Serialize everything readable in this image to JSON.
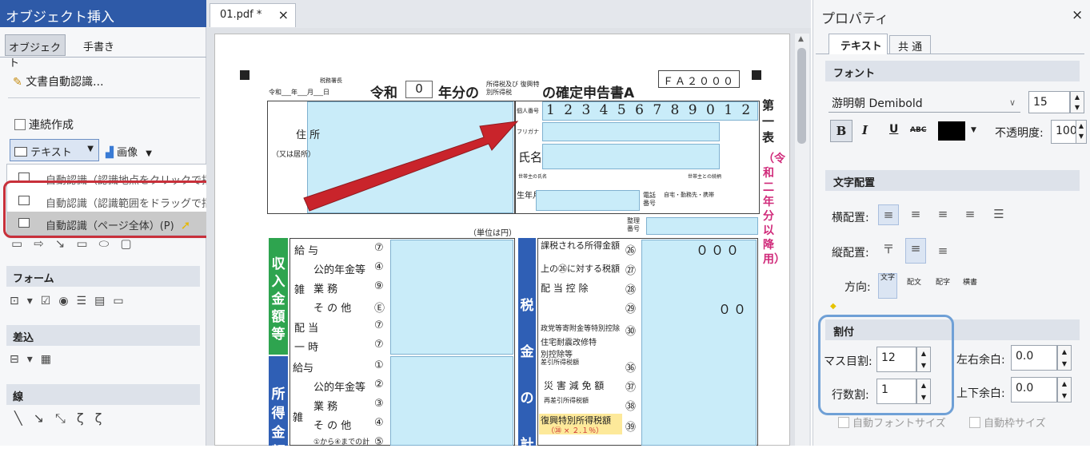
{
  "left_panel": {
    "title": "オブジェクト挿入",
    "close": "×",
    "tabs": [
      "オブジェクト",
      "手書き"
    ],
    "auto_recognize": "文書自動認識...",
    "continuous": "連続作成",
    "text_btn": "テキスト",
    "image_btn": "画像",
    "menu": [
      "自動認識（認識地点をクリックで指定）(M)",
      "自動認識（認識範囲をドラッグで指定）(A)",
      "自動認識（ページ全体）(P)"
    ],
    "sections": {
      "form": "フォーム",
      "merge": "差込",
      "line": "線"
    }
  },
  "document": {
    "tab": "01.pdf *",
    "tab_close": "×",
    "form": {
      "office": "税務署長",
      "date_line": "令和___年___月___日",
      "title_pre": "令和",
      "year_box": "0",
      "title_mid": "年分の",
      "title_small": "所得税及び 復興特別所得税",
      "title_post": "の確定申告書A",
      "code": "ＦＡ２０００",
      "side_title": "第一表",
      "side_sub": "（令和二年分以降用）",
      "address": "住 所",
      "address_sub": "（又は居所）",
      "personal_no_label": "個人番号",
      "personal_no": "1 2 3 4 5 6 7 8 9 0 1 2",
      "furigana": "フリガナ",
      "name": "氏名",
      "occupation": "世帯主の氏名",
      "relation": "世帯主との続柄",
      "birthdate": "生年月日",
      "phone": "電話番号",
      "phone_sub": "自宅・勤務先・携帯",
      "unit": "（単位は円）",
      "seiri": "整理番号",
      "income_vertical": "収入金額等",
      "shotoku_vertical": "所得金額",
      "tax_vertical": "税金の計",
      "income_rows": [
        "給 与",
        "公的年金等",
        "業 務",
        "そ の 他",
        "配 当",
        "一 時"
      ],
      "income_sub": "雑",
      "income_marks": [
        "⑦",
        "④",
        "⑨",
        "Ⓔ",
        "⑦",
        "⑦"
      ],
      "shotoku_rows": [
        "給与",
        "公的年金等",
        "業 務",
        "そ の 他",
        "①から④までの計"
      ],
      "shotoku_marks": [
        "①",
        "②",
        "③",
        "④",
        "⑤"
      ],
      "tax_rows": [
        "課税される所得金額",
        "上の㉖に対する税額",
        "配 当 控 除",
        "政党等寄附金等特別控除",
        "住宅耐震改修特別控除等",
        "差引所得税額",
        "災 害 減 免 額",
        "再差引所得税額",
        "復興特別所得税額"
      ],
      "tax_marks": [
        "㉖",
        "㉗",
        "㉘",
        "㉙",
        "㉚",
        "㊱",
        "㊲",
        "㊳",
        "㊴"
      ],
      "tax_values": [
        "０００",
        "",
        "",
        "００",
        "",
        "",
        "",
        "",
        ""
      ],
      "fukko_sub": "（㊳ × ２.１％）"
    }
  },
  "right_panel": {
    "title": "プロパティ",
    "close": "×",
    "tabs": [
      "テキスト",
      "共 通"
    ],
    "font_section": "フォント",
    "font_name": "游明朝 Demibold",
    "font_size": "15",
    "style_buttons": [
      "B",
      "I",
      "U",
      "ABC"
    ],
    "opacity_label": "不透明度:",
    "opacity": "100",
    "layout_section": "文字配置",
    "h_align": "横配置:",
    "v_align": "縦配置:",
    "direction": "方向:",
    "direction_opts": [
      "文字",
      "配文",
      "配字",
      "横書"
    ],
    "split_section": "割付",
    "mass": "マス目割:",
    "mass_val": "12",
    "lines": "行数割:",
    "lines_val": "1",
    "lr_margin": "左右余白:",
    "lr_val": "0.0",
    "tb_margin": "上下余白:",
    "tb_val": "0.0",
    "auto_font": "自動フォントサイズ",
    "auto_frame": "自動枠サイズ",
    "colors": {
      "font_color": "#000000"
    }
  }
}
